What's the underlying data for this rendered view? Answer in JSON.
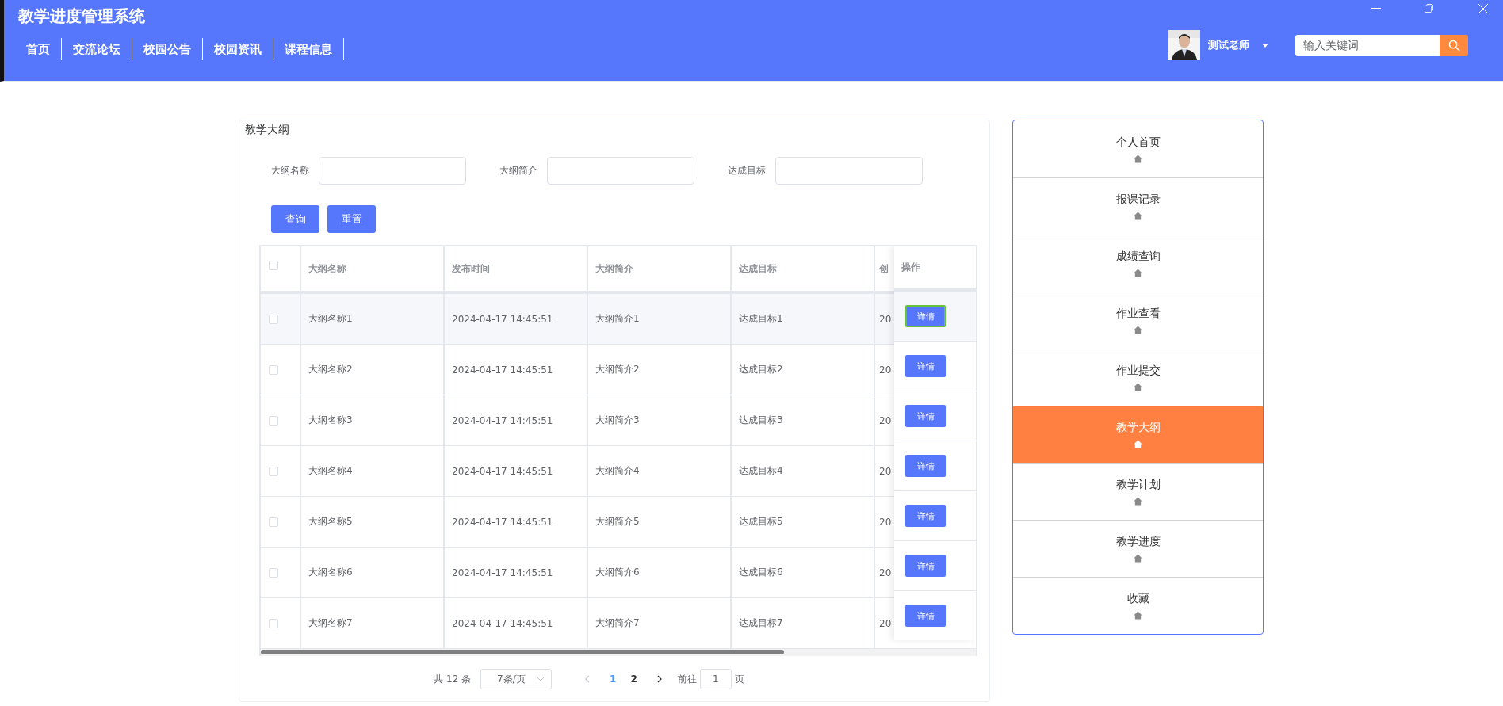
{
  "app": {
    "title": "教学进度管理系统"
  },
  "nav": [
    {
      "label": "首页"
    },
    {
      "label": "交流论坛"
    },
    {
      "label": "校园公告"
    },
    {
      "label": "校园资讯"
    },
    {
      "label": "课程信息"
    }
  ],
  "user": {
    "name": "测试老师"
  },
  "search": {
    "placeholder": "输入关键词"
  },
  "panel": {
    "title": "教学大纲",
    "filters": [
      {
        "label": "大纲名称"
      },
      {
        "label": "大纲简介"
      },
      {
        "label": "达成目标"
      }
    ],
    "buttons": [
      {
        "label": "查询"
      },
      {
        "label": "重置"
      }
    ],
    "table": {
      "columns": [
        "大纲名称",
        "发布时间",
        "大纲简介",
        "达成目标",
        "创"
      ],
      "action_column": "操作",
      "header_checked": false,
      "rows": [
        {
          "cells": [
            "大纲名称1",
            "2024-04-17 14:45:51",
            "大纲简介1",
            "达成目标1",
            "20"
          ],
          "action": "详情",
          "checked": false,
          "hovered": true
        },
        {
          "cells": [
            "大纲名称2",
            "2024-04-17 14:45:51",
            "大纲简介2",
            "达成目标2",
            "20"
          ],
          "action": "详情",
          "checked": false,
          "hovered": false
        },
        {
          "cells": [
            "大纲名称3",
            "2024-04-17 14:45:51",
            "大纲简介3",
            "达成目标3",
            "20"
          ],
          "action": "详情",
          "checked": false,
          "hovered": false
        },
        {
          "cells": [
            "大纲名称4",
            "2024-04-17 14:45:51",
            "大纲简介4",
            "达成目标4",
            "20"
          ],
          "action": "详情",
          "checked": false,
          "hovered": false
        },
        {
          "cells": [
            "大纲名称5",
            "2024-04-17 14:45:51",
            "大纲简介5",
            "达成目标5",
            "20"
          ],
          "action": "详情",
          "checked": false,
          "hovered": false
        },
        {
          "cells": [
            "大纲名称6",
            "2024-04-17 14:45:51",
            "大纲简介6",
            "达成目标6",
            "20"
          ],
          "action": "详情",
          "checked": false,
          "hovered": false
        },
        {
          "cells": [
            "大纲名称7",
            "2024-04-17 14:45:51",
            "大纲简介7",
            "达成目标7",
            "20"
          ],
          "action": "详情",
          "checked": false,
          "hovered": false
        }
      ]
    },
    "pagination": {
      "total": "共 12 条",
      "page_size": "7条/页",
      "pages": [
        {
          "label": "1",
          "selected": true
        },
        {
          "label": "2",
          "selected": false
        }
      ],
      "goto_label": "前往",
      "goto_value": "1",
      "goto_suffix": "页"
    }
  },
  "sidebar": {
    "items": [
      {
        "label": "个人首页",
        "selected": false
      },
      {
        "label": "报课记录",
        "selected": false
      },
      {
        "label": "成绩查询",
        "selected": false
      },
      {
        "label": "作业查看",
        "selected": false
      },
      {
        "label": "作业提交",
        "selected": false
      },
      {
        "label": "教学大纲",
        "selected": true
      },
      {
        "label": "教学计划",
        "selected": false
      },
      {
        "label": "教学进度",
        "selected": false
      },
      {
        "label": "收藏",
        "selected": false
      }
    ]
  }
}
